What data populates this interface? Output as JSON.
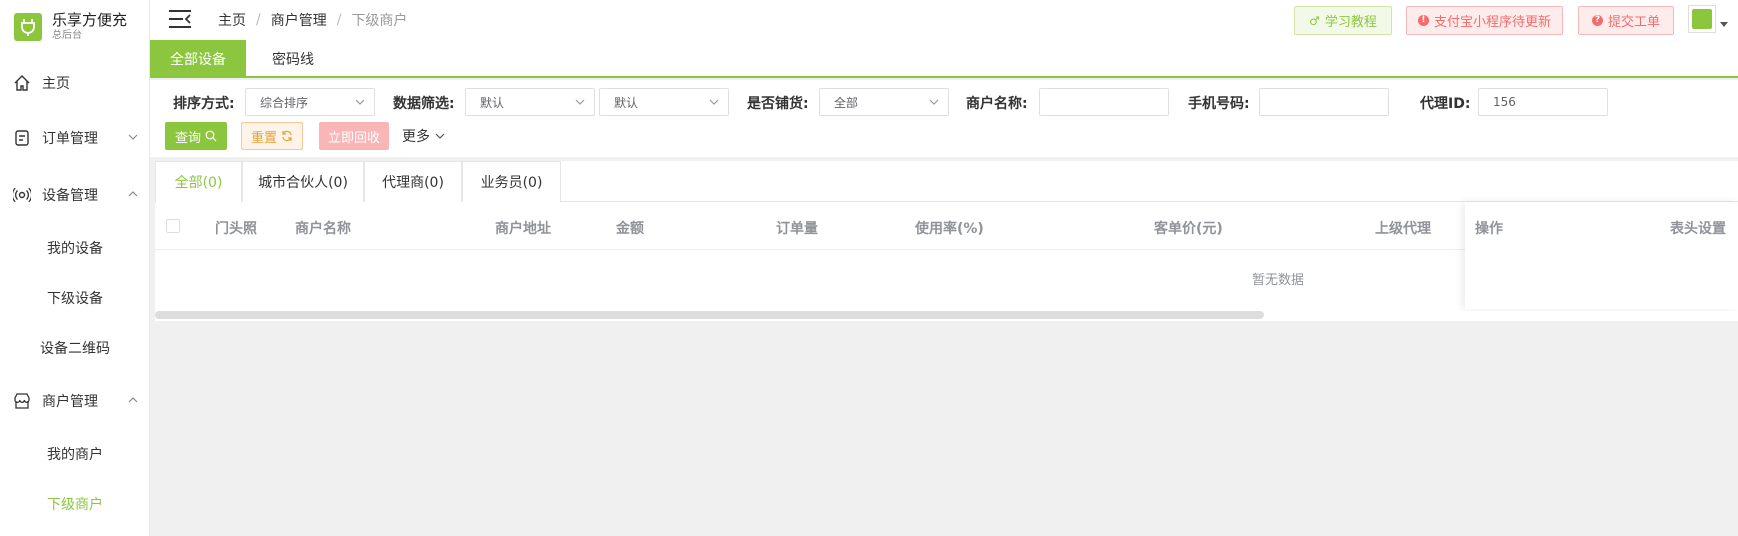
{
  "brand": {
    "title": "乐享方便充",
    "subtitle": "总后台"
  },
  "sidebar": {
    "items": [
      {
        "label": "主页",
        "icon": "home-icon"
      },
      {
        "label": "订单管理",
        "icon": "order-icon"
      },
      {
        "label": "设备管理",
        "icon": "device-icon"
      },
      {
        "label": "商户管理",
        "icon": "store-icon"
      }
    ],
    "device_sub": [
      "我的设备",
      "下级设备",
      "设备二维码"
    ],
    "merchant_sub": [
      "我的商户",
      "下级商户"
    ],
    "active_sub": "下级商户"
  },
  "header": {
    "breadcrumb": [
      "主页",
      "商户管理",
      "下级商户"
    ],
    "buttons": {
      "learn": "学习教程",
      "alipay": "支付宝小程序待更新",
      "ticket": "提交工单"
    }
  },
  "page_tabs": [
    "全部设备",
    "密码线"
  ],
  "filters": {
    "sort_label": "排序方式:",
    "sort_value": "综合排序",
    "data_label": "数据筛选:",
    "data_value1": "默认",
    "data_value2": "默认",
    "stock_label": "是否铺货:",
    "stock_value": "全部",
    "merchant_label": "商户名称:",
    "merchant_value": "",
    "phone_label": "手机号码:",
    "phone_value": "",
    "agent_label": "代理ID:",
    "agent_value": "156",
    "query_btn": "查询",
    "reset_btn": "重置",
    "recycle_btn": "立即回收",
    "more_btn": "更多"
  },
  "sub_tabs": [
    "全部(0)",
    "城市合伙人(0)",
    "代理商(0)",
    "业务员(0)"
  ],
  "table": {
    "columns": [
      "门头照",
      "商户名称",
      "商户地址",
      "金额",
      "订单量",
      "使用率(%)",
      "客单价(元)",
      "上级代理"
    ],
    "fixed_columns": [
      "操作",
      "表头设置"
    ],
    "empty_text": "暂无数据"
  },
  "colors": {
    "accent": "#8cc63f",
    "danger": "#f56c6c",
    "warning": "#e6a23c"
  }
}
